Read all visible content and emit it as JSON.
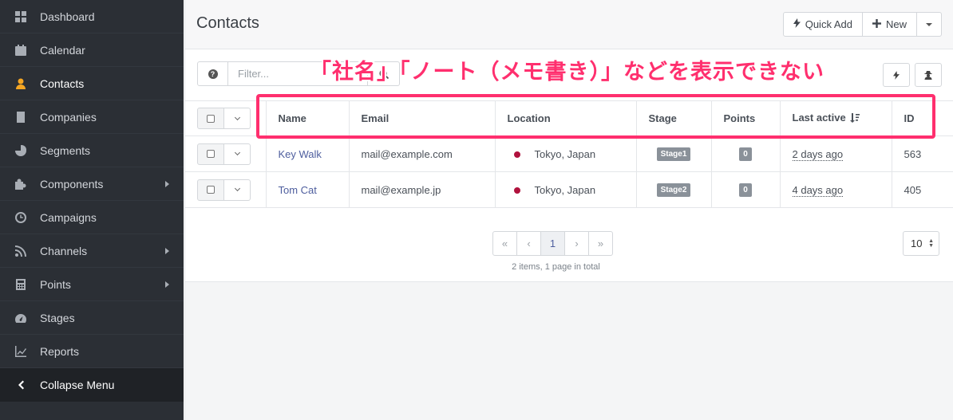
{
  "sidebar": {
    "items": [
      {
        "label": "Dashboard"
      },
      {
        "label": "Calendar"
      },
      {
        "label": "Contacts"
      },
      {
        "label": "Companies"
      },
      {
        "label": "Segments"
      },
      {
        "label": "Components"
      },
      {
        "label": "Campaigns"
      },
      {
        "label": "Channels"
      },
      {
        "label": "Points"
      },
      {
        "label": "Stages"
      },
      {
        "label": "Reports"
      }
    ],
    "collapse_label": "Collapse Menu",
    "active_item": "Contacts",
    "accent_color": "#f5a623"
  },
  "header": {
    "title": "Contacts",
    "quick_add_label": "Quick Add",
    "new_label": "New"
  },
  "toolbar": {
    "filter_placeholder": "Filter..."
  },
  "table": {
    "columns": [
      "Name",
      "Email",
      "Location",
      "Stage",
      "Points",
      "Last active",
      "ID"
    ],
    "rows": [
      {
        "name": "Key Walk",
        "email": "mail@example.com",
        "location": "Tokyo, Japan",
        "stage": "Stage1",
        "points": "0",
        "last_active": "2 days ago",
        "id": "563"
      },
      {
        "name": "Tom Cat",
        "email": "mail@example.jp",
        "location": "Tokyo, Japan",
        "stage": "Stage2",
        "points": "0",
        "last_active": "4 days ago",
        "id": "405"
      }
    ]
  },
  "pagination": {
    "first": "«",
    "prev": "‹",
    "current": "1",
    "next": "›",
    "last": "»",
    "info": "2 items, 1 page in total",
    "per_page": "10"
  },
  "annotation": {
    "text": "「社名」「ノート（メモ書き）」などを表示できない",
    "color": "#ff2f6e"
  }
}
